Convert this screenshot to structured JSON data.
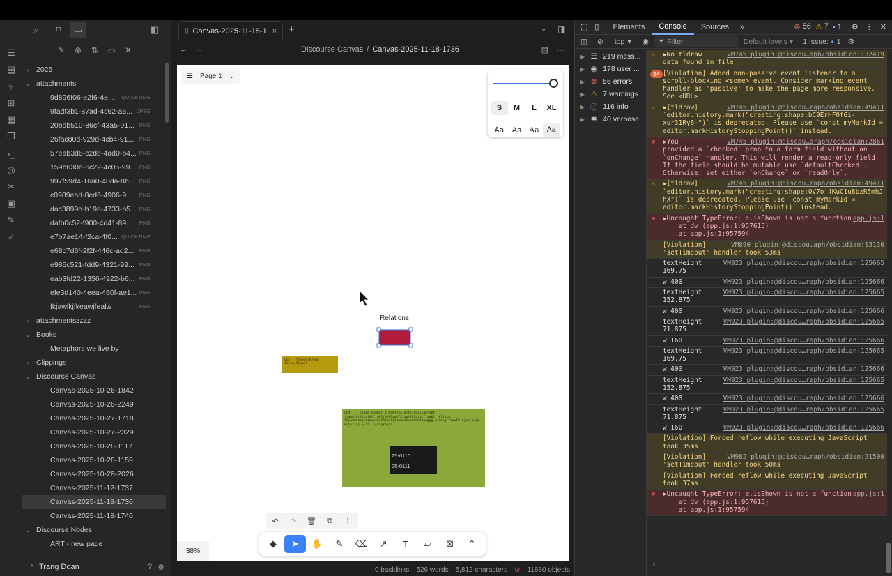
{
  "sidebar": {
    "footer_user": "Trang Doan",
    "tree": [
      {
        "kind": "folder",
        "open": false,
        "label": "2025",
        "depth": 0
      },
      {
        "kind": "folder",
        "open": true,
        "label": "attachments",
        "depth": 0
      },
      {
        "kind": "file",
        "label": "9d896f06-e2f6-4e...",
        "ext": "QUICKTIME",
        "depth": 1
      },
      {
        "kind": "file",
        "label": "9fadf3b1-87ad-4c62-a6...",
        "ext": "JPEG",
        "depth": 1
      },
      {
        "kind": "file",
        "label": "20bdb510-86cf-43a5-91...",
        "ext": "PNG",
        "depth": 1
      },
      {
        "kind": "file",
        "label": "26fac80d-929d-4cb4-91...",
        "ext": "PNG",
        "depth": 1
      },
      {
        "kind": "file",
        "label": "57eab3d6-c2de-4ad0-b4...",
        "ext": "PNG",
        "depth": 1
      },
      {
        "kind": "file",
        "label": "159b630e-6c22-4c05-99...",
        "ext": "PNG",
        "depth": 1
      },
      {
        "kind": "file",
        "label": "997f59d4-16a0-40da-8b...",
        "ext": "PNG",
        "depth": 1
      },
      {
        "kind": "file",
        "label": "c0989ead-8ed6-4906-9...",
        "ext": "PNG",
        "depth": 1
      },
      {
        "kind": "file",
        "label": "dac3899e-b19a-4733-b5...",
        "ext": "PNG",
        "depth": 1
      },
      {
        "kind": "file",
        "label": "dafb0c52-f900-4d41-89...",
        "ext": "PNG",
        "depth": 1
      },
      {
        "kind": "file",
        "label": "e7b7ae14-f2ca-4f0...",
        "ext": "QUICKTIME",
        "depth": 1
      },
      {
        "kind": "file",
        "label": "e68c7d6f-2f2f-446c-ad2...",
        "ext": "PNG",
        "depth": 1
      },
      {
        "kind": "file",
        "label": "e985c521-fdd9-4321-99...",
        "ext": "PNG",
        "depth": 1
      },
      {
        "kind": "file",
        "label": "eab3fd22-1356-4922-b6...",
        "ext": "PNG",
        "depth": 1
      },
      {
        "kind": "file",
        "label": "efe3d140-4eea-460f-ae1...",
        "ext": "PNG",
        "depth": 1
      },
      {
        "kind": "file",
        "label": "fkjawlkjfkeawjfealw",
        "ext": "PNG",
        "depth": 1
      },
      {
        "kind": "folder",
        "open": false,
        "label": "attachmentszzzz",
        "depth": 0
      },
      {
        "kind": "folder",
        "open": true,
        "label": "Books",
        "depth": 0
      },
      {
        "kind": "file",
        "label": "Metaphors we live by",
        "ext": "",
        "depth": 1
      },
      {
        "kind": "folder",
        "open": false,
        "label": "Clippings",
        "depth": 0
      },
      {
        "kind": "folder",
        "open": true,
        "label": "Discourse Canvas",
        "depth": 0
      },
      {
        "kind": "file",
        "label": "Canvas-2025-10-26-1842",
        "ext": "",
        "depth": 1
      },
      {
        "kind": "file",
        "label": "Canvas-2025-10-26-2249",
        "ext": "",
        "depth": 1
      },
      {
        "kind": "file",
        "label": "Canvas-2025-10-27-1718",
        "ext": "",
        "depth": 1
      },
      {
        "kind": "file",
        "label": "Canvas-2025-10-27-2329",
        "ext": "",
        "depth": 1
      },
      {
        "kind": "file",
        "label": "Canvas-2025-10-28-1117",
        "ext": "",
        "depth": 1
      },
      {
        "kind": "file",
        "label": "Canvas-2025-10-28-1159",
        "ext": "",
        "depth": 1
      },
      {
        "kind": "file",
        "label": "Canvas-2025-10-28-2026",
        "ext": "",
        "depth": 1
      },
      {
        "kind": "file",
        "label": "Canvas-2025-11-12-1737",
        "ext": "",
        "depth": 1
      },
      {
        "kind": "file",
        "label": "Canvas-2025-11-18-1736",
        "ext": "",
        "depth": 1,
        "selected": true
      },
      {
        "kind": "file",
        "label": "Canvas-2025-11-18-1740",
        "ext": "",
        "depth": 1
      },
      {
        "kind": "folder",
        "open": true,
        "label": "Discourse Nodes",
        "depth": 0
      },
      {
        "kind": "file",
        "label": "ART - new page",
        "ext": "",
        "depth": 1
      }
    ]
  },
  "tab": {
    "title": "Canvas-2025-11-18-1...",
    "close": "×",
    "new": "+"
  },
  "view": {
    "crumb_parent": "Discourse Canvas",
    "crumb_sep": "/",
    "crumb_current": "Canvas-2025-11-18-1736"
  },
  "canvas": {
    "page_label": "Page 1",
    "zoom": "38%",
    "relations_label": "Relations",
    "yellow_text": "QUE - fjakwjlkfeww fkjeajfjaawl",
    "green_text": "CLM - - claim number 2 mlkfjkalajfklawjklawjjkf fjawalkjfklajklfjaklfejklawjfklawjfklajklfjawklfjklfkla fkjawkfkajlfjawalkjfklajfjiawawituhwkwhfkwaggg ajkieg fiawfk kjwh kwjd kljafiaj w.aa. ajkdjkajjd",
    "dark_lines": [
      "25-0110",
      "25-0111"
    ],
    "sizes": [
      "S",
      "M",
      "L",
      "XL"
    ],
    "fonts": [
      "Aa",
      "Aa",
      "Aa",
      "Aa"
    ]
  },
  "status": {
    "backlinks": "0 backlinks",
    "words": "526 words",
    "chars": "5,812 characters",
    "objects": "11680 objects"
  },
  "devtools": {
    "tabs": [
      "Elements",
      "Console",
      "Sources"
    ],
    "errors": "56",
    "warnings": "7",
    "infos": "1",
    "context": "top",
    "filter_placeholder": "Filter",
    "levels": "Default levels",
    "issues": "1 Issue:",
    "issues_count": "1",
    "side": [
      {
        "icon": "☰",
        "label": "219 mess..."
      },
      {
        "icon": "◉",
        "label": "178 user ..."
      },
      {
        "icon": "⊗",
        "label": "56 errors"
      },
      {
        "icon": "⚠",
        "label": "7 warnings"
      },
      {
        "icon": "ⓘ",
        "label": "116 info"
      },
      {
        "icon": "✱",
        "label": "40 verbose"
      }
    ],
    "messages": [
      {
        "type": "warn",
        "icon": "⚠",
        "text": "▶No tldraw   \ndata found in file",
        "src": "VM745 plugin:@discou…aph/obsidian:132419"
      },
      {
        "type": "warn",
        "icon": "",
        "badge": "34",
        "text": "[Violation] Added non-passive event listener to a scroll-blocking <some> event. Consider marking event handler as 'passive' to make the page more responsive. See <URL>",
        "src": ""
      },
      {
        "type": "warn",
        "icon": "⚠",
        "text": "▶[tldraw]      \n`editor.history.mark(\"creating:shape:bC9ErHF0fGi-xur31Ry8-\")` is deprecated. Please use `const myMarkId = editor.markHistoryStoppingPoint()` instead.",
        "src": "VM745 plugin:@discou…raph/obsidian:49411"
      },
      {
        "type": "err",
        "icon": "⊗",
        "text": "▶You           \nprovided a `checked` prop to a form field without an `onChange` handler. This will render a read-only field. If the field should be mutable use `defaultChecked`. Otherwise, set either `onChange` or `readOnly`.",
        "src": "VM745 plugin:@discou…graph/obsidian:2861"
      },
      {
        "type": "warn",
        "icon": "⚠",
        "text": "▶[tldraw]      \n`editor.history.mark(\"creating:shape:0V7oj4KuC1u8bzR5mhJhX\")` is deprecated. Please use `const myMarkId = editor.markHistoryStoppingPoint()` instead.",
        "src": "VM745 plugin:@discou…raph/obsidian:49411"
      },
      {
        "type": "err",
        "icon": "⊗",
        "text": "▶Uncaught TypeError: e.isShown is not a function\n    at dv (app.js:1:957615)\n    at app.js:1:957594",
        "src": "app.js:1"
      },
      {
        "type": "warn",
        "icon": "",
        "text": "[Violation]   \n'setTimeout' handler took 53ms",
        "src": "VM890 plugin:@discou…aph/obsidian:13130"
      },
      {
        "type": "log",
        "icon": "",
        "text": "textHeight\n169.75",
        "src": "VM923 plugin:@discou…raph/obsidian:125665"
      },
      {
        "type": "log",
        "icon": "",
        "text": "w 400",
        "src": "VM923 plugin:@discou…raph/obsidian:125666"
      },
      {
        "type": "log",
        "icon": "",
        "text": "textHeight\n152.875",
        "src": "VM923 plugin:@discou…raph/obsidian:125665"
      },
      {
        "type": "log",
        "icon": "",
        "text": "w 400",
        "src": "VM923 plugin:@discou…raph/obsidian:125666"
      },
      {
        "type": "log",
        "icon": "",
        "text": "textHeight\n71.875",
        "src": "VM923 plugin:@discou…raph/obsidian:125665"
      },
      {
        "type": "log",
        "icon": "",
        "text": "w 160",
        "src": "VM923 plugin:@discou…raph/obsidian:125666"
      },
      {
        "type": "log",
        "icon": "",
        "text": "textHeight\n169.75",
        "src": "VM923 plugin:@discou…raph/obsidian:125665"
      },
      {
        "type": "log",
        "icon": "",
        "text": "w 400",
        "src": "VM923 plugin:@discou…raph/obsidian:125666"
      },
      {
        "type": "log",
        "icon": "",
        "text": "textHeight\n152.875",
        "src": "VM923 plugin:@discou…raph/obsidian:125665"
      },
      {
        "type": "log",
        "icon": "",
        "text": "w 400",
        "src": "VM923 plugin:@discou…raph/obsidian:125666"
      },
      {
        "type": "log",
        "icon": "",
        "text": "textHeight\n71.875",
        "src": "VM923 plugin:@discou…raph/obsidian:125665"
      },
      {
        "type": "log",
        "icon": "",
        "text": "w 160",
        "src": "VM923 plugin:@discou…raph/obsidian:125666"
      },
      {
        "type": "warn",
        "icon": "",
        "text": "[Violation] Forced reflow while executing JavaScript took 35ms",
        "src": ""
      },
      {
        "type": "warn",
        "icon": "",
        "text": "[Violation]   \n'setTimeout' handler took 50ms",
        "src": "VM982 plugin:@discou…raph/obsidian:21500"
      },
      {
        "type": "warn",
        "icon": "",
        "text": "[Violation] Forced reflow while executing JavaScript took 37ms",
        "src": ""
      },
      {
        "type": "err",
        "icon": "⊗",
        "text": "▶Uncaught TypeError: e.isShown is not a function\n    at dv (app.js:1:957615)\n    at app.js:1:957594",
        "src": "app.js:1"
      }
    ]
  }
}
